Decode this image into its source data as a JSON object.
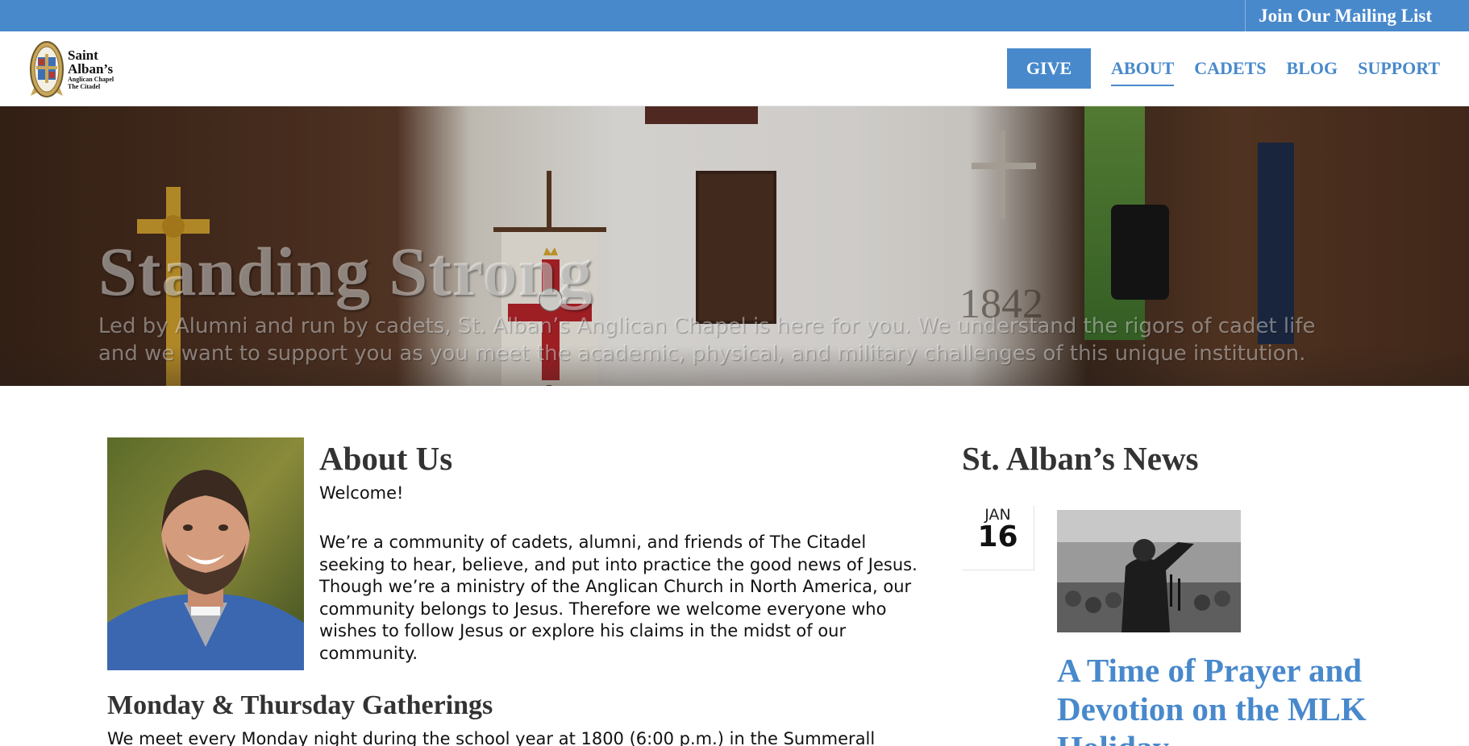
{
  "topbar": {
    "mailing_list": "Join Our Mailing List"
  },
  "header": {
    "logo": {
      "line1": "Saint",
      "line2": "Alban’s",
      "line3": "Anglican Chapel",
      "line4": "The Citadel"
    },
    "give_label": "GIVE",
    "nav": [
      "ABOUT",
      "CADETS",
      "BLOG",
      "SUPPORT"
    ],
    "active_nav": "ABOUT"
  },
  "hero": {
    "title": "Standing Strong",
    "text": "Led by Alumni and run by cadets, St. Alban’s Anglican Chapel is here for you. We understand the rigors of cadet life and we want to support you as you meet the academic, physical, and military challenges of this unique institution.",
    "year": "1842"
  },
  "about": {
    "title": "About Us",
    "welcome": "Welcome!",
    "body": "We’re a community of cadets, alumni, and friends of The Citadel seeking to hear, believe, and put into practice the good news of Jesus. Though we’re a ministry of the Anglican Church in North America, our community belongs to Jesus. Therefore we welcome everyone who wishes to follow Jesus or explore his claims in the midst of our community.",
    "gatherings_title": "Monday & Thursday Gatherings",
    "gatherings_text": "We meet every Monday night during the school year at 1800 (6:00 p.m.) in the Summerall"
  },
  "news": {
    "title": "St. Alban’s News",
    "items": [
      {
        "month": "JAN",
        "day": "16",
        "headline": "A Time of Prayer and Devotion on the MLK Holiday"
      }
    ]
  },
  "colors": {
    "accent": "#4889cc",
    "heading": "#333333"
  }
}
